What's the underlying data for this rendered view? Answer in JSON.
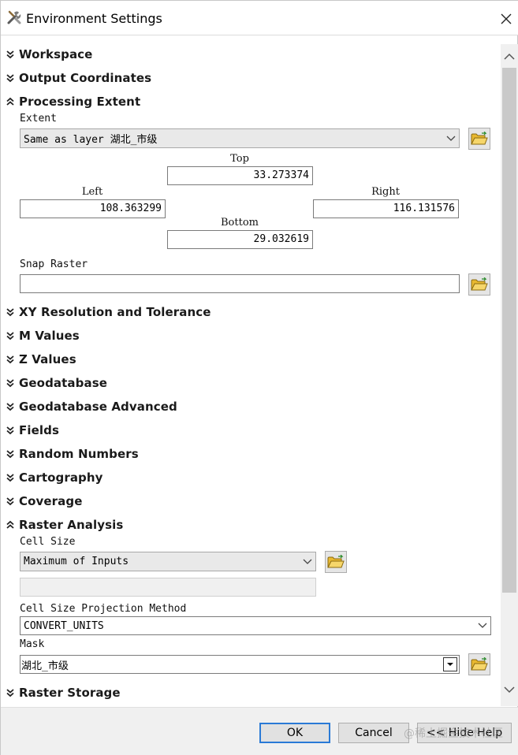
{
  "window": {
    "title": "Environment Settings",
    "app_icon": "tools-icon",
    "close_icon": "close-icon"
  },
  "sections": {
    "workspace": "Workspace",
    "output_coordinates": "Output Coordinates",
    "processing_extent": "Processing Extent",
    "xy_resolution": "XY Resolution and Tolerance",
    "m_values": "M Values",
    "z_values": "Z Values",
    "geodatabase": "Geodatabase",
    "geodatabase_advanced": "Geodatabase Advanced",
    "fields": "Fields",
    "random_numbers": "Random Numbers",
    "cartography": "Cartography",
    "coverage": "Coverage",
    "raster_analysis": "Raster Analysis",
    "raster_storage": "Raster Storage"
  },
  "processing_extent": {
    "extent_label": "Extent",
    "extent_value": "Same as layer 湖北_市级",
    "top_label": "Top",
    "top_value": "33.273374",
    "left_label": "Left",
    "left_value": "108.363299",
    "right_label": "Right",
    "right_value": "116.131576",
    "bottom_label": "Bottom",
    "bottom_value": "29.032619",
    "snap_raster_label": "Snap Raster",
    "snap_raster_value": ""
  },
  "raster_analysis": {
    "cell_size_label": "Cell Size",
    "cell_size_value": "Maximum of Inputs",
    "cell_size_text": "",
    "projection_method_label": "Cell Size Projection Method",
    "projection_method_value": "CONVERT_UNITS",
    "mask_label": "Mask",
    "mask_value": "湖北_市级"
  },
  "buttons": {
    "ok": "OK",
    "cancel": "Cancel",
    "hide_help": "<< Hide Help"
  },
  "watermark": "@稀土掘金技术社区",
  "colors": {
    "accent": "#2a7ad6",
    "dialog_bg": "#f0f0f0",
    "folder": "#e8b830"
  }
}
